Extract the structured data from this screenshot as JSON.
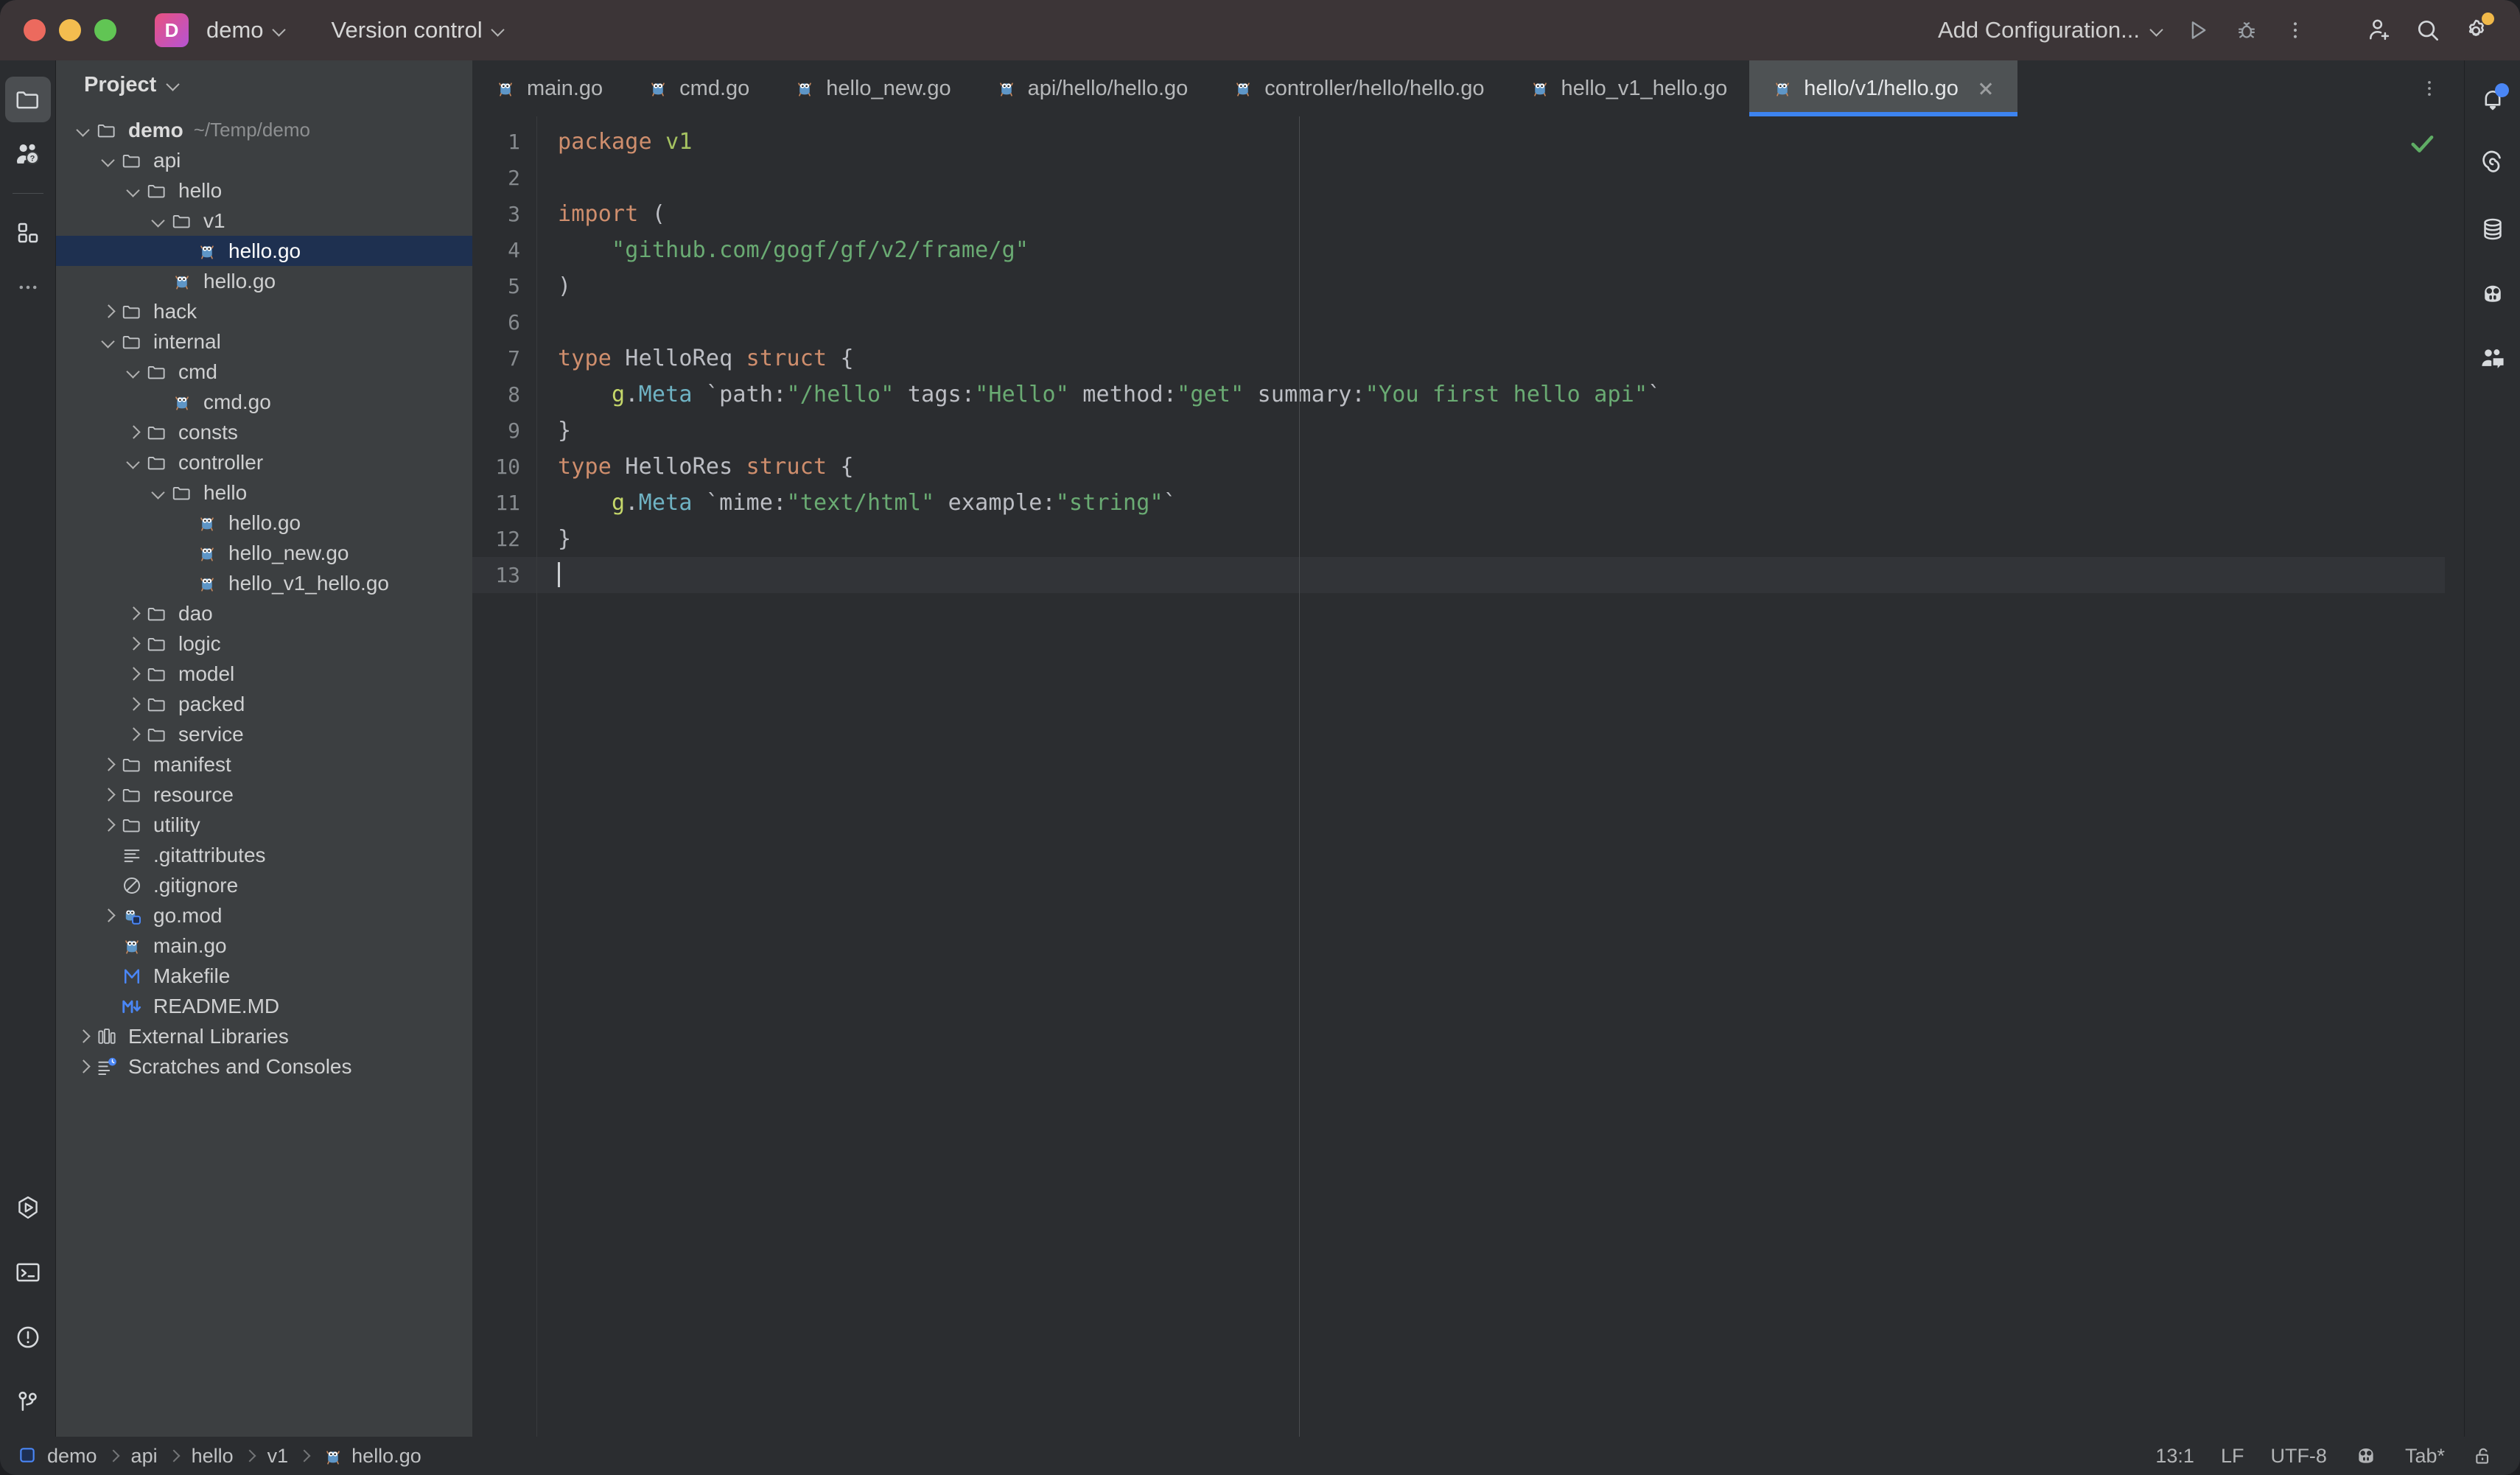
{
  "window": {
    "project_badge": "D",
    "project_name": "demo",
    "version_control": "Version control",
    "add_configuration": "Add Configuration..."
  },
  "left_rail": {
    "items": [
      {
        "name": "project-tool-window",
        "icon": "folder-icon",
        "active": true
      },
      {
        "name": "learn-tool-window",
        "icon": "person-question-icon",
        "active": false
      },
      {
        "name": "plugins-tool-window",
        "icon": "squares-icon",
        "active": false
      },
      {
        "name": "more-tool-windows",
        "icon": "ellipsis-icon",
        "active": false
      }
    ],
    "bottom_items": [
      {
        "name": "run-tool-window",
        "icon": "run-hexagon-icon"
      },
      {
        "name": "terminal-tool-window",
        "icon": "terminal-icon"
      },
      {
        "name": "problems-tool-window",
        "icon": "warning-circle-icon"
      },
      {
        "name": "git-tool-window",
        "icon": "git-branch-icon"
      }
    ]
  },
  "right_rail": {
    "items": [
      {
        "name": "notifications",
        "icon": "bell-icon",
        "badge": true
      },
      {
        "name": "ai-assistant",
        "icon": "spiral-icon",
        "badge": false
      },
      {
        "name": "database",
        "icon": "database-icon",
        "badge": false
      },
      {
        "name": "code-with-me",
        "icon": "gopher-face-icon",
        "badge": false
      },
      {
        "name": "chat",
        "icon": "people-chat-icon",
        "badge": false
      }
    ]
  },
  "project_panel": {
    "title": "Project",
    "tree": [
      {
        "depth": 0,
        "arrow": "down",
        "icon": "folder-icon",
        "label": "demo",
        "sub": "~/Temp/demo",
        "bold": true,
        "selected": false
      },
      {
        "depth": 1,
        "arrow": "down",
        "icon": "folder-icon",
        "label": "api",
        "selected": false
      },
      {
        "depth": 2,
        "arrow": "down",
        "icon": "folder-icon",
        "label": "hello",
        "selected": false
      },
      {
        "depth": 3,
        "arrow": "down",
        "icon": "folder-icon",
        "label": "v1",
        "selected": false
      },
      {
        "depth": 4,
        "arrow": "none",
        "icon": "go-file-icon",
        "label": "hello.go",
        "selected": true
      },
      {
        "depth": 3,
        "arrow": "none",
        "icon": "go-file-icon",
        "label": "hello.go",
        "selected": false
      },
      {
        "depth": 1,
        "arrow": "right",
        "icon": "folder-icon",
        "label": "hack",
        "selected": false
      },
      {
        "depth": 1,
        "arrow": "down",
        "icon": "folder-icon",
        "label": "internal",
        "selected": false
      },
      {
        "depth": 2,
        "arrow": "down",
        "icon": "folder-icon",
        "label": "cmd",
        "selected": false
      },
      {
        "depth": 3,
        "arrow": "none",
        "icon": "go-file-icon",
        "label": "cmd.go",
        "selected": false
      },
      {
        "depth": 2,
        "arrow": "right",
        "icon": "folder-icon",
        "label": "consts",
        "selected": false
      },
      {
        "depth": 2,
        "arrow": "down",
        "icon": "folder-icon",
        "label": "controller",
        "selected": false
      },
      {
        "depth": 3,
        "arrow": "down",
        "icon": "folder-icon",
        "label": "hello",
        "selected": false
      },
      {
        "depth": 4,
        "arrow": "none",
        "icon": "go-file-icon",
        "label": "hello.go",
        "selected": false
      },
      {
        "depth": 4,
        "arrow": "none",
        "icon": "go-file-icon",
        "label": "hello_new.go",
        "selected": false
      },
      {
        "depth": 4,
        "arrow": "none",
        "icon": "go-file-icon",
        "label": "hello_v1_hello.go",
        "selected": false
      },
      {
        "depth": 2,
        "arrow": "right",
        "icon": "folder-icon",
        "label": "dao",
        "selected": false
      },
      {
        "depth": 2,
        "arrow": "right",
        "icon": "folder-icon",
        "label": "logic",
        "selected": false
      },
      {
        "depth": 2,
        "arrow": "right",
        "icon": "folder-icon",
        "label": "model",
        "selected": false
      },
      {
        "depth": 2,
        "arrow": "right",
        "icon": "folder-icon",
        "label": "packed",
        "selected": false
      },
      {
        "depth": 2,
        "arrow": "right",
        "icon": "folder-icon",
        "label": "service",
        "selected": false
      },
      {
        "depth": 1,
        "arrow": "right",
        "icon": "folder-icon",
        "label": "manifest",
        "selected": false
      },
      {
        "depth": 1,
        "arrow": "right",
        "icon": "folder-icon",
        "label": "resource",
        "selected": false
      },
      {
        "depth": 1,
        "arrow": "right",
        "icon": "folder-icon",
        "label": "utility",
        "selected": false
      },
      {
        "depth": 1,
        "arrow": "none",
        "icon": "text-file-icon",
        "label": ".gitattributes",
        "selected": false
      },
      {
        "depth": 1,
        "arrow": "none",
        "icon": "gitignore-icon",
        "label": ".gitignore",
        "selected": false
      },
      {
        "depth": 1,
        "arrow": "right",
        "icon": "gomod-icon",
        "label": "go.mod",
        "selected": false
      },
      {
        "depth": 1,
        "arrow": "none",
        "icon": "go-file-icon",
        "label": "main.go",
        "selected": false
      },
      {
        "depth": 1,
        "arrow": "none",
        "icon": "makefile-icon",
        "label": "Makefile",
        "selected": false
      },
      {
        "depth": 1,
        "arrow": "none",
        "icon": "markdown-icon",
        "label": "README.MD",
        "selected": false
      },
      {
        "depth": 0,
        "arrow": "right",
        "icon": "library-icon",
        "label": "External Libraries",
        "selected": false
      },
      {
        "depth": 0,
        "arrow": "right",
        "icon": "scratches-icon",
        "label": "Scratches and Consoles",
        "selected": false
      }
    ]
  },
  "editor": {
    "tabs": [
      {
        "label": "main.go",
        "icon": "go-file-icon",
        "active": false,
        "closable": false
      },
      {
        "label": "cmd.go",
        "icon": "go-file-icon",
        "active": false,
        "closable": false
      },
      {
        "label": "hello_new.go",
        "icon": "go-file-icon",
        "active": false,
        "closable": false
      },
      {
        "label": "api/hello/hello.go",
        "icon": "go-file-icon",
        "active": false,
        "closable": false
      },
      {
        "label": "controller/hello/hello.go",
        "icon": "go-file-icon",
        "active": false,
        "closable": false
      },
      {
        "label": "hello_v1_hello.go",
        "icon": "go-file-icon",
        "active": false,
        "closable": false
      },
      {
        "label": "hello/v1/hello.go",
        "icon": "go-file-icon",
        "active": true,
        "closable": true
      }
    ],
    "line_numbers": [
      "1",
      "2",
      "3",
      "4",
      "5",
      "6",
      "7",
      "8",
      "9",
      "10",
      "11",
      "12",
      "13"
    ],
    "current_line": 13,
    "inspection_status": "ok",
    "code_lines": [
      {
        "n": 1,
        "tokens": [
          {
            "t": "package",
            "c": "kw"
          },
          {
            "t": " ",
            "c": "punct"
          },
          {
            "t": "v1",
            "c": "pkg"
          }
        ]
      },
      {
        "n": 2,
        "tokens": []
      },
      {
        "n": 3,
        "tokens": [
          {
            "t": "import",
            "c": "kw"
          },
          {
            "t": " (",
            "c": "punct"
          }
        ]
      },
      {
        "n": 4,
        "tokens": [
          {
            "t": "    ",
            "c": "punct"
          },
          {
            "t": "\"github.com/gogf/gf/v2/frame/g\"",
            "c": "str"
          }
        ]
      },
      {
        "n": 5,
        "tokens": [
          {
            "t": ")",
            "c": "punct"
          }
        ]
      },
      {
        "n": 6,
        "tokens": []
      },
      {
        "n": 7,
        "tokens": [
          {
            "t": "type",
            "c": "kw"
          },
          {
            "t": " HelloReq ",
            "c": "ident"
          },
          {
            "t": "struct",
            "c": "kw"
          },
          {
            "t": " {",
            "c": "punct"
          }
        ]
      },
      {
        "n": 8,
        "tokens": [
          {
            "t": "    ",
            "c": "punct"
          },
          {
            "t": "g",
            "c": "fld"
          },
          {
            "t": ".",
            "c": "punct"
          },
          {
            "t": "Meta",
            "c": "prop"
          },
          {
            "t": " `path:",
            "c": "ident"
          },
          {
            "t": "\"/hello\"",
            "c": "str"
          },
          {
            "t": " tags:",
            "c": "ident"
          },
          {
            "t": "\"Hello\"",
            "c": "str"
          },
          {
            "t": " method:",
            "c": "ident"
          },
          {
            "t": "\"get\"",
            "c": "str"
          },
          {
            "t": " summary:",
            "c": "ident"
          },
          {
            "t": "\"You first hello api\"",
            "c": "str"
          },
          {
            "t": "`",
            "c": "ident"
          }
        ]
      },
      {
        "n": 9,
        "tokens": [
          {
            "t": "}",
            "c": "punct"
          }
        ]
      },
      {
        "n": 10,
        "tokens": [
          {
            "t": "type",
            "c": "kw"
          },
          {
            "t": " HelloRes ",
            "c": "ident"
          },
          {
            "t": "struct",
            "c": "kw"
          },
          {
            "t": " {",
            "c": "punct"
          }
        ]
      },
      {
        "n": 11,
        "tokens": [
          {
            "t": "    ",
            "c": "punct"
          },
          {
            "t": "g",
            "c": "fld"
          },
          {
            "t": ".",
            "c": "punct"
          },
          {
            "t": "Meta",
            "c": "prop"
          },
          {
            "t": " `mime:",
            "c": "ident"
          },
          {
            "t": "\"text/html\"",
            "c": "str"
          },
          {
            "t": " example:",
            "c": "ident"
          },
          {
            "t": "\"string\"",
            "c": "str"
          },
          {
            "t": "`",
            "c": "ident"
          }
        ]
      },
      {
        "n": 12,
        "tokens": [
          {
            "t": "}",
            "c": "punct"
          }
        ]
      },
      {
        "n": 13,
        "tokens": [],
        "caret": true
      }
    ]
  },
  "status_bar": {
    "breadcrumbs": [
      {
        "label": "demo",
        "icon": "module-icon"
      },
      {
        "label": "api",
        "icon": "none"
      },
      {
        "label": "hello",
        "icon": "none"
      },
      {
        "label": "v1",
        "icon": "none"
      },
      {
        "label": "hello.go",
        "icon": "go-file-icon"
      }
    ],
    "caret_position": "13:1",
    "line_separator": "LF",
    "encoding": "UTF-8",
    "indent": "Tab*",
    "code_with_me_icon": "gopher-face-icon",
    "lock_icon": "unlocked-icon"
  },
  "colors": {
    "accent_blue": "#3d84f0",
    "selection_navy": "#1e3050",
    "keyword_orange": "#cf8e6d",
    "string_green": "#6aab73",
    "field_olive": "#c5d76a",
    "property_teal": "#6fb3c4",
    "checkmark_green": "#5fad65",
    "titlebar_mauve": "#3c3537",
    "panel_gray": "#3c3f41",
    "editor_bg": "#2b2d30"
  }
}
